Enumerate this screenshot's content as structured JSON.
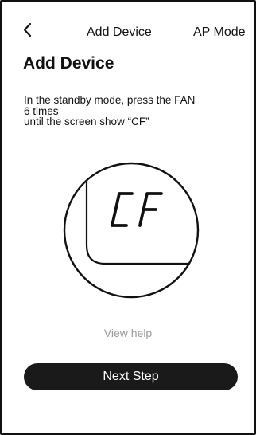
{
  "header": {
    "back_icon": "chevron-left-icon",
    "title": "Add Device",
    "ap_mode_label": "AP Mode"
  },
  "main": {
    "page_title": "Add Device",
    "instruction_lines": [
      "In the standby mode, press the FAN",
      "6 times",
      "until the screen show “CF”"
    ],
    "display_code": "CF",
    "view_help_label": "View help",
    "next_step_label": "Next Step"
  },
  "colors": {
    "background": "#ffffff",
    "text": "#111111",
    "muted_text": "#9a9a9a",
    "button": "#1a1a1a",
    "button_text": "#ffffff"
  }
}
